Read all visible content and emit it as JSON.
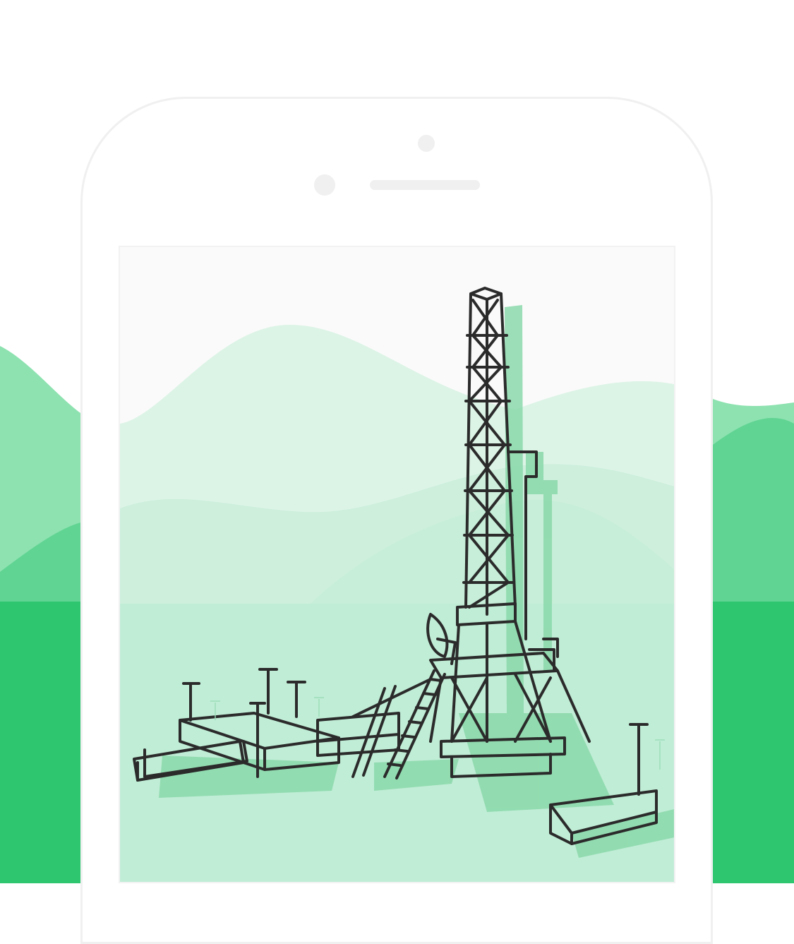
{
  "colors": {
    "background": "#ffffff",
    "frame": "#f0f0f0",
    "hill_light": "#8de2b0",
    "hill_mid": "#60d492",
    "ground": "#2ec770",
    "screen_hill_light": "#dcf4e6",
    "screen_hill_mid": "#cdefdc",
    "screen_ground": "#c0edd6",
    "rig_shadow": "#8ad8aa",
    "line_art": "#2b2b2b"
  },
  "illustration": {
    "subject": "drilling-rig-illustration",
    "icons": [
      "camera-icon",
      "sensor-icon",
      "speaker-icon"
    ]
  }
}
